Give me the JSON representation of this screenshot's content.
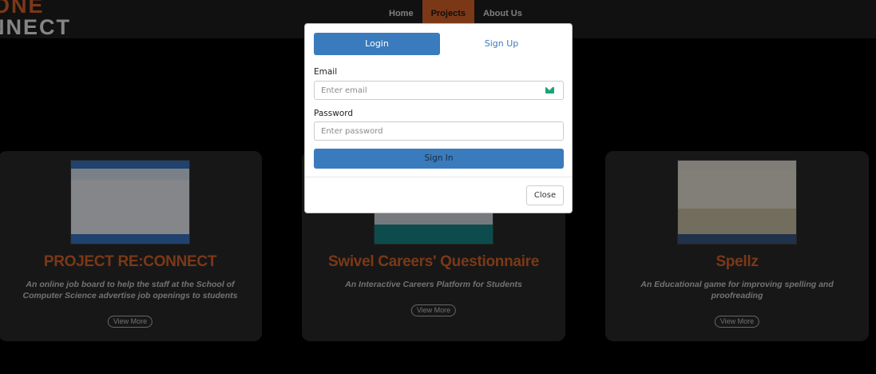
{
  "header": {
    "logo_line1": "ONE",
    "logo_line2": "NNECT",
    "nav": [
      {
        "label": "Home",
        "active": false
      },
      {
        "label": "Projects",
        "active": true
      },
      {
        "label": "About Us",
        "active": false
      }
    ]
  },
  "cards": [
    {
      "title": "PROJECT RE:CONNECT",
      "description": "An online job board to help the staff at the School of Computer Science advertise job openings to students",
      "button": "View More"
    },
    {
      "title": "Swivel Careers' Questionnaire",
      "description": "An Interactive Careers Platform for Students",
      "button": "View More"
    },
    {
      "title": "Spellz",
      "description": "An Educational game for improving spelling and proofreading",
      "button": "View More"
    }
  ],
  "modal": {
    "tabs": {
      "login": "Login",
      "signup": "Sign Up"
    },
    "email": {
      "label": "Email",
      "placeholder": "Enter email",
      "value": ""
    },
    "password": {
      "label": "Password",
      "placeholder": "Enter password",
      "value": ""
    },
    "submit": "Sign In",
    "close": "Close"
  },
  "colors": {
    "accent": "#e0672b",
    "primary": "#3a7bbd",
    "background": "#000000",
    "card": "#2a2a2a"
  },
  "icons": {
    "email_field": "envelope-icon"
  }
}
